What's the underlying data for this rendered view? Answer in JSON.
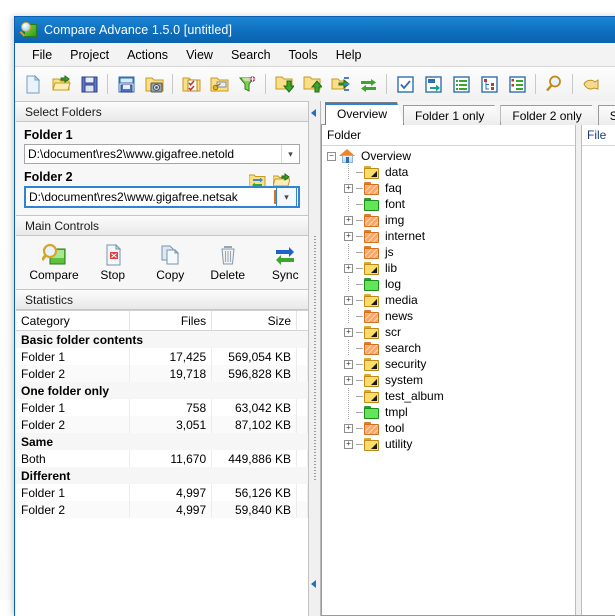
{
  "window": {
    "title": "Compare Advance 1.5.0 [untitled]",
    "app_icon": "magnifier-folder-icon"
  },
  "menu": {
    "items": [
      {
        "label": "File"
      },
      {
        "label": "Project"
      },
      {
        "label": "Actions"
      },
      {
        "label": "View"
      },
      {
        "label": "Search"
      },
      {
        "label": "Tools"
      },
      {
        "label": "Help"
      }
    ]
  },
  "toolbar": {
    "buttons": [
      {
        "name": "new-project-icon",
        "title": "New"
      },
      {
        "name": "open-project-icon",
        "title": "Open"
      },
      {
        "name": "save-project-icon",
        "title": "Save"
      },
      {
        "name": "sep1",
        "title": ""
      },
      {
        "name": "save-report-icon",
        "title": "Save report"
      },
      {
        "name": "snapshot-folder-icon",
        "title": "Snapshot"
      },
      {
        "name": "sep2",
        "title": ""
      },
      {
        "name": "select-checked-folder-icon",
        "title": "Select"
      },
      {
        "name": "folder-properties-icon",
        "title": "Properties"
      },
      {
        "name": "filter-icon",
        "title": "Filter"
      },
      {
        "name": "sep3",
        "title": ""
      },
      {
        "name": "copy-down-icon",
        "title": "Copy to Folder 2"
      },
      {
        "name": "copy-left-icon",
        "title": "Copy to Folder 1"
      },
      {
        "name": "copy-right-icon",
        "title": "Copy"
      },
      {
        "name": "sync-folders-icon",
        "title": "Sync"
      },
      {
        "name": "sep4",
        "title": ""
      },
      {
        "name": "check-all-icon",
        "title": "Check all"
      },
      {
        "name": "goto-icon",
        "title": "Go to"
      },
      {
        "name": "list-view-icon",
        "title": "List view"
      },
      {
        "name": "tree-view-icon",
        "title": "Tree view"
      },
      {
        "name": "split-view-icon",
        "title": "Split view"
      },
      {
        "name": "sep5",
        "title": ""
      },
      {
        "name": "search-icon",
        "title": "Search"
      },
      {
        "name": "sep6",
        "title": ""
      },
      {
        "name": "help-icon",
        "title": "Help"
      }
    ]
  },
  "select_folders": {
    "group_title": "Select Folders",
    "folder1_label": "Folder 1",
    "folder1_value": "D:\\document\\res2\\www.gigafree.netold",
    "folder2_label": "Folder 2",
    "folder2_value": "D:\\document\\res2\\www.gigafree.netsak",
    "swap_button": "swap-folders-icon",
    "browse_button": "browse-folder-icon"
  },
  "main_controls": {
    "group_title": "Main Controls",
    "buttons": [
      {
        "label": "Compare",
        "icon": "magnifier-compare-icon"
      },
      {
        "label": "Stop",
        "icon": "stop-document-icon"
      },
      {
        "label": "Copy",
        "icon": "copy-documents-icon"
      },
      {
        "label": "Delete",
        "icon": "trash-can-icon"
      },
      {
        "label": "Sync",
        "icon": "sync-arrows-icon"
      }
    ]
  },
  "statistics": {
    "group_title": "Statistics",
    "columns": [
      "Category",
      "Files",
      "Size"
    ],
    "rows": [
      {
        "type": "group",
        "label": "Basic folder contents",
        "files": "",
        "size": ""
      },
      {
        "type": "item",
        "label": "Folder 1",
        "files": "17,425",
        "size": "569,054 KB"
      },
      {
        "type": "item",
        "label": "Folder 2",
        "files": "19,718",
        "size": "596,828 KB"
      },
      {
        "type": "group",
        "label": "One folder only",
        "files": "",
        "size": ""
      },
      {
        "type": "item",
        "label": "Folder 1",
        "files": "758",
        "size": "63,042 KB"
      },
      {
        "type": "item",
        "label": "Folder 2",
        "files": "3,051",
        "size": "87,102 KB"
      },
      {
        "type": "group",
        "label": "Same",
        "files": "",
        "size": ""
      },
      {
        "type": "item",
        "label": "Both",
        "files": "11,670",
        "size": "449,886 KB"
      },
      {
        "type": "group",
        "label": "Different",
        "files": "",
        "size": ""
      },
      {
        "type": "item",
        "label": "Folder 1",
        "files": "4,997",
        "size": "56,126 KB"
      },
      {
        "type": "item",
        "label": "Folder 2",
        "files": "4,997",
        "size": "59,840 KB"
      }
    ]
  },
  "tabs": {
    "items": [
      {
        "label": "Overview",
        "active": true
      },
      {
        "label": "Folder 1 only",
        "active": false
      },
      {
        "label": "Folder 2 only",
        "active": false
      },
      {
        "label": "Same",
        "active": false
      }
    ]
  },
  "tree_panel": {
    "column_header": "Folder",
    "root": {
      "label": "Overview",
      "icon": "house-icon",
      "expander": "minus"
    },
    "nodes": [
      {
        "label": "data",
        "icon": "folder-yellow",
        "expander": "none"
      },
      {
        "label": "faq",
        "icon": "folder-orange",
        "expander": "plus"
      },
      {
        "label": "font",
        "icon": "folder-green",
        "expander": "none"
      },
      {
        "label": "img",
        "icon": "folder-orange",
        "expander": "plus"
      },
      {
        "label": "internet",
        "icon": "folder-orange",
        "expander": "plus"
      },
      {
        "label": "js",
        "icon": "folder-orange",
        "expander": "none"
      },
      {
        "label": "lib",
        "icon": "folder-yellow",
        "expander": "plus"
      },
      {
        "label": "log",
        "icon": "folder-green",
        "expander": "none"
      },
      {
        "label": "media",
        "icon": "folder-yellow",
        "expander": "plus"
      },
      {
        "label": "news",
        "icon": "folder-orange",
        "expander": "none"
      },
      {
        "label": "scr",
        "icon": "folder-yellow",
        "expander": "plus"
      },
      {
        "label": "search",
        "icon": "folder-orange",
        "expander": "none"
      },
      {
        "label": "security",
        "icon": "folder-yellow",
        "expander": "plus"
      },
      {
        "label": "system",
        "icon": "folder-yellow",
        "expander": "plus"
      },
      {
        "label": "test_album",
        "icon": "folder-yellow",
        "expander": "none"
      },
      {
        "label": "tmpl",
        "icon": "folder-green",
        "expander": "none"
      },
      {
        "label": "tool",
        "icon": "folder-orange",
        "expander": "plus"
      },
      {
        "label": "utility",
        "icon": "folder-yellow",
        "expander": "plus"
      }
    ]
  },
  "file_panel": {
    "column_header": "File"
  },
  "colors": {
    "titlebar": "#0e6fbf",
    "accent": "#2f83d2",
    "folder_yellow": "#fcdc6a",
    "folder_orange": "#fba767",
    "folder_green": "#62e657",
    "house_roof": "#f0852a"
  }
}
